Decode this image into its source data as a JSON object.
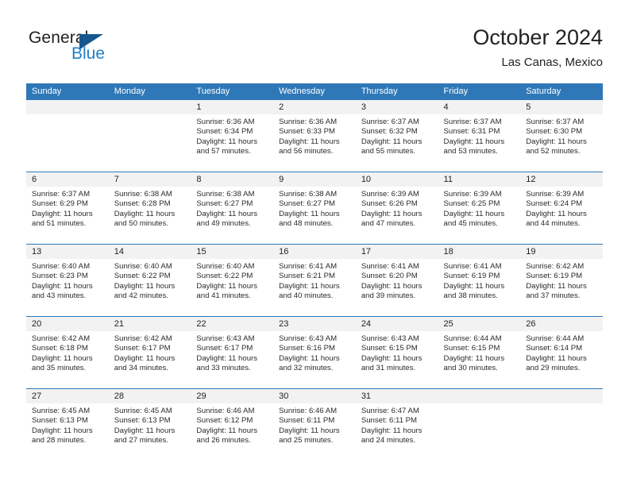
{
  "brand": {
    "word_general": "General",
    "word_blue": "Blue",
    "triangle_color": "#17578e",
    "blue_text_color": "#1f7fc4"
  },
  "header": {
    "title": "October 2024",
    "subtitle": "Las Canas, Mexico"
  },
  "theme": {
    "header_blue": "#2e78b8",
    "daynum_band": "#f2f2f2",
    "text": "#222222"
  },
  "calendar": {
    "weekday_headers": [
      "Sunday",
      "Monday",
      "Tuesday",
      "Wednesday",
      "Thursday",
      "Friday",
      "Saturday"
    ],
    "weeks": [
      [
        {
          "day": "",
          "lines": []
        },
        {
          "day": "",
          "lines": []
        },
        {
          "day": "1",
          "lines": [
            "Sunrise: 6:36 AM",
            "Sunset: 6:34 PM",
            "Daylight: 11 hours",
            "and 57 minutes."
          ]
        },
        {
          "day": "2",
          "lines": [
            "Sunrise: 6:36 AM",
            "Sunset: 6:33 PM",
            "Daylight: 11 hours",
            "and 56 minutes."
          ]
        },
        {
          "day": "3",
          "lines": [
            "Sunrise: 6:37 AM",
            "Sunset: 6:32 PM",
            "Daylight: 11 hours",
            "and 55 minutes."
          ]
        },
        {
          "day": "4",
          "lines": [
            "Sunrise: 6:37 AM",
            "Sunset: 6:31 PM",
            "Daylight: 11 hours",
            "and 53 minutes."
          ]
        },
        {
          "day": "5",
          "lines": [
            "Sunrise: 6:37 AM",
            "Sunset: 6:30 PM",
            "Daylight: 11 hours",
            "and 52 minutes."
          ]
        }
      ],
      [
        {
          "day": "6",
          "lines": [
            "Sunrise: 6:37 AM",
            "Sunset: 6:29 PM",
            "Daylight: 11 hours",
            "and 51 minutes."
          ]
        },
        {
          "day": "7",
          "lines": [
            "Sunrise: 6:38 AM",
            "Sunset: 6:28 PM",
            "Daylight: 11 hours",
            "and 50 minutes."
          ]
        },
        {
          "day": "8",
          "lines": [
            "Sunrise: 6:38 AM",
            "Sunset: 6:27 PM",
            "Daylight: 11 hours",
            "and 49 minutes."
          ]
        },
        {
          "day": "9",
          "lines": [
            "Sunrise: 6:38 AM",
            "Sunset: 6:27 PM",
            "Daylight: 11 hours",
            "and 48 minutes."
          ]
        },
        {
          "day": "10",
          "lines": [
            "Sunrise: 6:39 AM",
            "Sunset: 6:26 PM",
            "Daylight: 11 hours",
            "and 47 minutes."
          ]
        },
        {
          "day": "11",
          "lines": [
            "Sunrise: 6:39 AM",
            "Sunset: 6:25 PM",
            "Daylight: 11 hours",
            "and 45 minutes."
          ]
        },
        {
          "day": "12",
          "lines": [
            "Sunrise: 6:39 AM",
            "Sunset: 6:24 PM",
            "Daylight: 11 hours",
            "and 44 minutes."
          ]
        }
      ],
      [
        {
          "day": "13",
          "lines": [
            "Sunrise: 6:40 AM",
            "Sunset: 6:23 PM",
            "Daylight: 11 hours",
            "and 43 minutes."
          ]
        },
        {
          "day": "14",
          "lines": [
            "Sunrise: 6:40 AM",
            "Sunset: 6:22 PM",
            "Daylight: 11 hours",
            "and 42 minutes."
          ]
        },
        {
          "day": "15",
          "lines": [
            "Sunrise: 6:40 AM",
            "Sunset: 6:22 PM",
            "Daylight: 11 hours",
            "and 41 minutes."
          ]
        },
        {
          "day": "16",
          "lines": [
            "Sunrise: 6:41 AM",
            "Sunset: 6:21 PM",
            "Daylight: 11 hours",
            "and 40 minutes."
          ]
        },
        {
          "day": "17",
          "lines": [
            "Sunrise: 6:41 AM",
            "Sunset: 6:20 PM",
            "Daylight: 11 hours",
            "and 39 minutes."
          ]
        },
        {
          "day": "18",
          "lines": [
            "Sunrise: 6:41 AM",
            "Sunset: 6:19 PM",
            "Daylight: 11 hours",
            "and 38 minutes."
          ]
        },
        {
          "day": "19",
          "lines": [
            "Sunrise: 6:42 AM",
            "Sunset: 6:19 PM",
            "Daylight: 11 hours",
            "and 37 minutes."
          ]
        }
      ],
      [
        {
          "day": "20",
          "lines": [
            "Sunrise: 6:42 AM",
            "Sunset: 6:18 PM",
            "Daylight: 11 hours",
            "and 35 minutes."
          ]
        },
        {
          "day": "21",
          "lines": [
            "Sunrise: 6:42 AM",
            "Sunset: 6:17 PM",
            "Daylight: 11 hours",
            "and 34 minutes."
          ]
        },
        {
          "day": "22",
          "lines": [
            "Sunrise: 6:43 AM",
            "Sunset: 6:17 PM",
            "Daylight: 11 hours",
            "and 33 minutes."
          ]
        },
        {
          "day": "23",
          "lines": [
            "Sunrise: 6:43 AM",
            "Sunset: 6:16 PM",
            "Daylight: 11 hours",
            "and 32 minutes."
          ]
        },
        {
          "day": "24",
          "lines": [
            "Sunrise: 6:43 AM",
            "Sunset: 6:15 PM",
            "Daylight: 11 hours",
            "and 31 minutes."
          ]
        },
        {
          "day": "25",
          "lines": [
            "Sunrise: 6:44 AM",
            "Sunset: 6:15 PM",
            "Daylight: 11 hours",
            "and 30 minutes."
          ]
        },
        {
          "day": "26",
          "lines": [
            "Sunrise: 6:44 AM",
            "Sunset: 6:14 PM",
            "Daylight: 11 hours",
            "and 29 minutes."
          ]
        }
      ],
      [
        {
          "day": "27",
          "lines": [
            "Sunrise: 6:45 AM",
            "Sunset: 6:13 PM",
            "Daylight: 11 hours",
            "and 28 minutes."
          ]
        },
        {
          "day": "28",
          "lines": [
            "Sunrise: 6:45 AM",
            "Sunset: 6:13 PM",
            "Daylight: 11 hours",
            "and 27 minutes."
          ]
        },
        {
          "day": "29",
          "lines": [
            "Sunrise: 6:46 AM",
            "Sunset: 6:12 PM",
            "Daylight: 11 hours",
            "and 26 minutes."
          ]
        },
        {
          "day": "30",
          "lines": [
            "Sunrise: 6:46 AM",
            "Sunset: 6:11 PM",
            "Daylight: 11 hours",
            "and 25 minutes."
          ]
        },
        {
          "day": "31",
          "lines": [
            "Sunrise: 6:47 AM",
            "Sunset: 6:11 PM",
            "Daylight: 11 hours",
            "and 24 minutes."
          ]
        },
        {
          "day": "",
          "lines": []
        },
        {
          "day": "",
          "lines": []
        }
      ]
    ]
  }
}
